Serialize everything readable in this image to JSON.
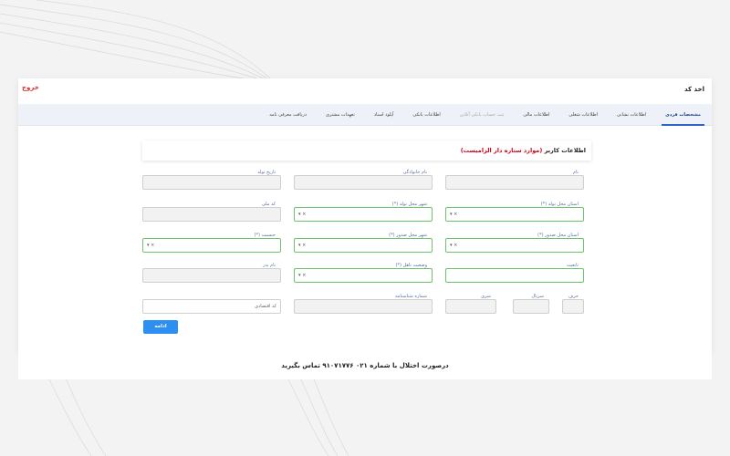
{
  "header": {
    "brand": "اخذ کد",
    "logout": "خروج"
  },
  "tabs": [
    {
      "label": "مشخصات فردی",
      "state": "active"
    },
    {
      "label": "اطلاعات نشانی",
      "state": "normal"
    },
    {
      "label": "اطلاعات شغلی",
      "state": "normal"
    },
    {
      "label": "اطلاعات مالی",
      "state": "normal"
    },
    {
      "label": "ثبت حساب بانکی آنلاین",
      "state": "disabled"
    },
    {
      "label": "اطلاعات بانکی",
      "state": "normal"
    },
    {
      "label": "آپلود اسناد",
      "state": "normal"
    },
    {
      "label": "تعهدات مشتری",
      "state": "normal"
    },
    {
      "label": "دریافت معرفی نامه",
      "state": "normal"
    }
  ],
  "form": {
    "title": "اطلاعات کاربر",
    "required_note": "(موارد ستاره دار الزامیست)",
    "fields": {
      "name": {
        "label": "نام"
      },
      "family": {
        "label": "نام خانوادگی"
      },
      "birth_date": {
        "label": "تاریخ تولد"
      },
      "birth_province": {
        "label": "استان محل تولد (*)"
      },
      "birth_city": {
        "label": "شهر محل تولد (*)"
      },
      "national_code": {
        "label": "کد ملی"
      },
      "issue_province": {
        "label": "استان محل صدور (*)"
      },
      "issue_city": {
        "label": "شهر محل صدور (*)"
      },
      "gender": {
        "label": "جنسیت (*)"
      },
      "nationality": {
        "label": "تابعیت"
      },
      "marital_status": {
        "label": "وضعیت تاهل (*)"
      },
      "father_name": {
        "label": "نام پدر"
      },
      "letter": {
        "label": "حرف"
      },
      "serial": {
        "label": "سریال"
      },
      "series": {
        "label": "سری"
      },
      "id_number": {
        "label": "شماره شناسنامه"
      },
      "economic_code": {
        "label": "",
        "value": "کد اقتصادی"
      }
    },
    "select_clear": "×",
    "select_caret": "▾",
    "submit_label": "ادامه"
  },
  "footer": {
    "text": "درصورت اختلال با شماره ۰۲۱ ۹۱۰۷۱۷۷۶ تماس بگیرید"
  },
  "colors": {
    "accent": "#2d8ff0",
    "required": "#d0021b",
    "select_border": "#6bc46b"
  }
}
